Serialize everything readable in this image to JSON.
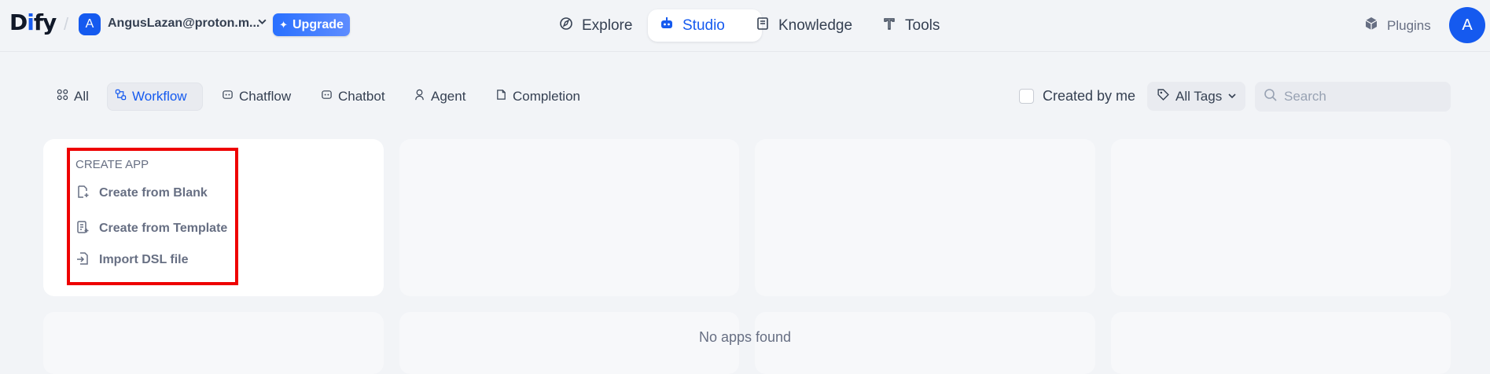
{
  "header": {
    "logo": {
      "prefix": "D",
      "dot": "i",
      "suffix": "fy"
    },
    "workspace": {
      "avatar": "A",
      "name": "AngusLazan@proton.m..."
    },
    "upgrade_label": "Upgrade",
    "nav": [
      {
        "label": "Explore",
        "icon": "compass-icon"
      },
      {
        "label": "Studio",
        "icon": "robot-icon",
        "active": true
      },
      {
        "label": "Knowledge",
        "icon": "book-icon"
      },
      {
        "label": "Tools",
        "icon": "tools-icon"
      }
    ],
    "plugins_label": "Plugins",
    "user_avatar": "A"
  },
  "filters": {
    "tabs": [
      {
        "label": "All",
        "icon": "grid-icon"
      },
      {
        "label": "Workflow",
        "icon": "workflow-icon",
        "active": true
      },
      {
        "label": "Chatflow",
        "icon": "chatflow-icon"
      },
      {
        "label": "Chatbot",
        "icon": "chatbot-icon"
      },
      {
        "label": "Agent",
        "icon": "agent-icon"
      },
      {
        "label": "Completion",
        "icon": "document-icon"
      }
    ],
    "created_by_me": {
      "label": "Created by me",
      "checked": false
    },
    "tags_label": "All Tags",
    "search_placeholder": "Search"
  },
  "create_app": {
    "title": "CREATE APP",
    "items": [
      {
        "label": "Create from Blank",
        "icon": "blank-file-icon"
      },
      {
        "label": "Create from Template",
        "icon": "template-icon"
      },
      {
        "label": "Import DSL file",
        "icon": "import-icon"
      }
    ]
  },
  "empty_message": "No apps found",
  "colors": {
    "accent": "#155aef",
    "highlight": "#ee0000",
    "background": "#f2f4f7"
  }
}
